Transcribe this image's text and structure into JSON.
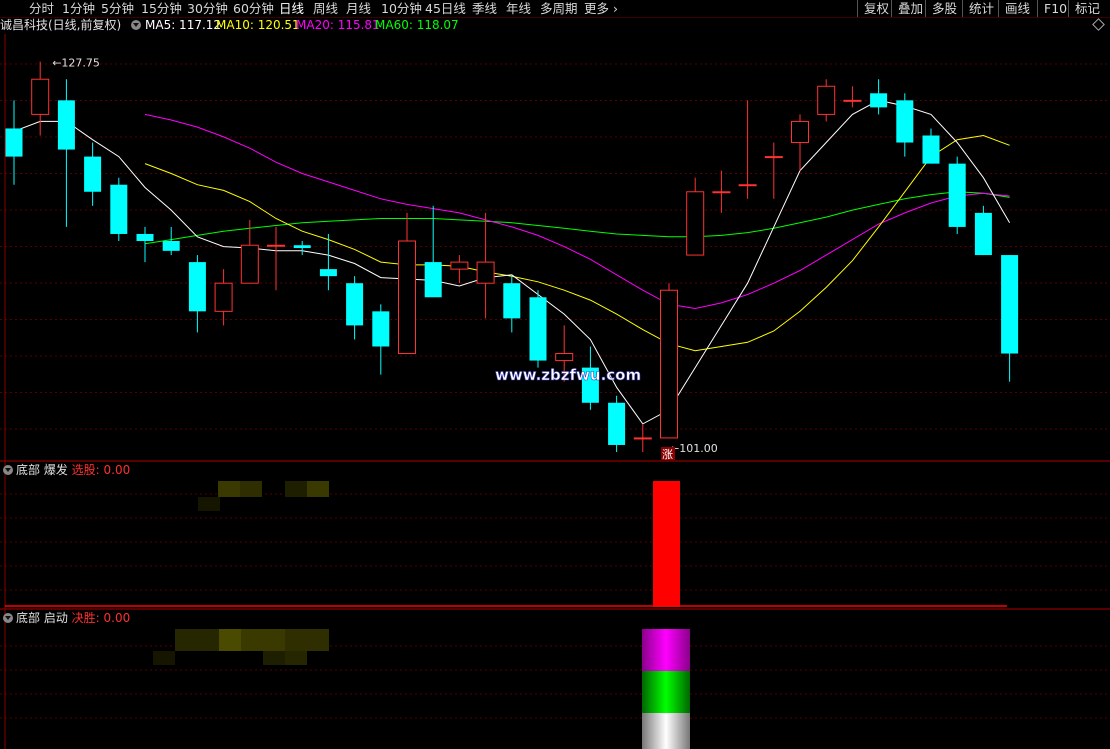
{
  "toolbar": {
    "periods": [
      "分时",
      "1分钟",
      "5分钟",
      "15分钟",
      "30分钟",
      "60分钟",
      "日线",
      "周线",
      "月线",
      "10分钟",
      "45日线",
      "季线",
      "年线",
      "多周期",
      "更多"
    ],
    "active_period": "日线",
    "right_items": [
      "复权",
      "叠加",
      "多股",
      "统计",
      "画线",
      "F10",
      "标记"
    ]
  },
  "stock": {
    "title": "诚昌科技(日线,前复权)"
  },
  "ma_legend": [
    {
      "label": "MA5:",
      "value": "117.12",
      "color": "#ffffff"
    },
    {
      "label": "MA10:",
      "value": "120.51",
      "color": "#ffff00"
    },
    {
      "label": "MA20:",
      "value": "115.81",
      "color": "#ff00ff"
    },
    {
      "label": "MA60:",
      "value": "118.07",
      "color": "#00ff00"
    }
  ],
  "annotations": {
    "high": "127.75",
    "low": "101.00",
    "limit_up_tag": "涨"
  },
  "watermark": "www.zbzfwu.com",
  "panel2": {
    "name": "底部 爆发",
    "indicator": "选股: 0.00"
  },
  "panel3": {
    "name": "底部 启动",
    "indicator": "决胜: 0.00"
  },
  "colors": {
    "up": "#ff3232",
    "down": "#00ffff",
    "ma5": "#ffffff",
    "ma10": "#ffff00",
    "ma20": "#ff00ff",
    "ma60": "#00ff00"
  },
  "chart_data": {
    "type": "candlestick",
    "price_range": [
      100.0,
      130.0
    ],
    "candles": [
      {
        "o": 123.0,
        "h": 125.0,
        "l": 119.0,
        "c": 121.0
      },
      {
        "o": 124.0,
        "h": 127.75,
        "l": 122.5,
        "c": 126.5
      },
      {
        "o": 125.0,
        "h": 126.5,
        "l": 116.0,
        "c": 121.5
      },
      {
        "o": 121.0,
        "h": 122.0,
        "l": 117.5,
        "c": 118.5
      },
      {
        "o": 119.0,
        "h": 119.5,
        "l": 115.0,
        "c": 115.5
      },
      {
        "o": 115.5,
        "h": 116.0,
        "l": 113.5,
        "c": 115.0
      },
      {
        "o": 115.0,
        "h": 116.0,
        "l": 114.0,
        "c": 114.3
      },
      {
        "o": 113.5,
        "h": 114.0,
        "l": 108.5,
        "c": 110.0
      },
      {
        "o": 110.0,
        "h": 113.0,
        "l": 109.0,
        "c": 112.0
      },
      {
        "o": 112.0,
        "h": 116.5,
        "l": 112.0,
        "c": 114.7
      },
      {
        "o": 114.7,
        "h": 116.0,
        "l": 111.5,
        "c": 114.7
      },
      {
        "o": 114.7,
        "h": 115.0,
        "l": 114.0,
        "c": 114.5
      },
      {
        "o": 113.0,
        "h": 115.5,
        "l": 111.5,
        "c": 112.5
      },
      {
        "o": 112.0,
        "h": 112.5,
        "l": 108.0,
        "c": 109.0
      },
      {
        "o": 110.0,
        "h": 110.5,
        "l": 105.5,
        "c": 107.5
      },
      {
        "o": 107.0,
        "h": 117.0,
        "l": 107.0,
        "c": 115.0
      },
      {
        "o": 113.5,
        "h": 117.5,
        "l": 111.5,
        "c": 111.0
      },
      {
        "o": 113.0,
        "h": 114.0,
        "l": 112.0,
        "c": 113.5
      },
      {
        "o": 112.0,
        "h": 117.0,
        "l": 109.5,
        "c": 113.5
      },
      {
        "o": 112.0,
        "h": 112.5,
        "l": 108.5,
        "c": 109.5
      },
      {
        "o": 111.0,
        "h": 111.5,
        "l": 106.0,
        "c": 106.5
      },
      {
        "o": 106.5,
        "h": 109.0,
        "l": 105.0,
        "c": 107.0
      },
      {
        "o": 106.0,
        "h": 107.5,
        "l": 103.0,
        "c": 103.5
      },
      {
        "o": 103.5,
        "h": 104.0,
        "l": 100.0,
        "c": 100.5
      },
      {
        "o": 101.0,
        "h": 102.0,
        "l": 100.0,
        "c": 101.0
      },
      {
        "o": 101.0,
        "h": 112.0,
        "l": 101.0,
        "c": 111.5
      },
      {
        "o": 114.0,
        "h": 119.5,
        "l": 114.0,
        "c": 118.5
      },
      {
        "o": 118.5,
        "h": 120.0,
        "l": 117.0,
        "c": 118.5
      },
      {
        "o": 119.0,
        "h": 125.0,
        "l": 118.0,
        "c": 119.0
      },
      {
        "o": 121.0,
        "h": 122.0,
        "l": 118.0,
        "c": 121.0
      },
      {
        "o": 122.0,
        "h": 124.0,
        "l": 120.0,
        "c": 123.5
      },
      {
        "o": 124.0,
        "h": 126.5,
        "l": 123.5,
        "c": 126.0
      },
      {
        "o": 125.0,
        "h": 126.0,
        "l": 124.5,
        "c": 125.0
      },
      {
        "o": 125.5,
        "h": 126.5,
        "l": 124.0,
        "c": 124.5
      },
      {
        "o": 125.0,
        "h": 125.5,
        "l": 121.0,
        "c": 122.0
      },
      {
        "o": 122.5,
        "h": 123.0,
        "l": 120.5,
        "c": 120.5
      },
      {
        "o": 120.5,
        "h": 121.0,
        "l": 115.5,
        "c": 116.0
      },
      {
        "o": 117.0,
        "h": 117.5,
        "l": 114.0,
        "c": 114.0
      },
      {
        "o": 114.0,
        "h": 114.0,
        "l": 105.0,
        "c": 107.0
      }
    ],
    "ma5": [
      122.8,
      123.5,
      123.5,
      122.2,
      121.0,
      118.8,
      117.2,
      115.3,
      114.6,
      114.5,
      114.3,
      114.3,
      114.0,
      113.4,
      112.4,
      112.3,
      112.2,
      111.8,
      112.4,
      112.6,
      111.2,
      109.8,
      108.0,
      104.6,
      102.0,
      103.0,
      106.0,
      109.0,
      112.0,
      116.0,
      120.0,
      122.0,
      124.0,
      125.0,
      124.6,
      124.0,
      122.0,
      119.5,
      116.3
    ],
    "ma10": [
      null,
      null,
      null,
      null,
      null,
      120.5,
      119.8,
      119.0,
      118.6,
      117.8,
      116.6,
      115.7,
      115.1,
      114.4,
      113.5,
      113.3,
      113.3,
      113.2,
      112.8,
      112.5,
      112.1,
      111.5,
      110.8,
      109.8,
      108.7,
      107.7,
      107.2,
      107.5,
      107.8,
      108.6,
      110.0,
      111.7,
      113.6,
      116.0,
      118.5,
      121.0,
      122.2,
      122.5,
      121.8
    ],
    "ma20": [
      null,
      null,
      null,
      null,
      null,
      124.0,
      123.6,
      123.1,
      122.4,
      121.6,
      120.6,
      119.8,
      119.2,
      118.6,
      118.0,
      117.6,
      117.3,
      117.0,
      116.5,
      116.0,
      115.4,
      114.6,
      113.7,
      112.6,
      111.5,
      110.5,
      110.2,
      110.6,
      111.2,
      112.0,
      112.9,
      114.0,
      115.1,
      116.2,
      117.0,
      117.7,
      118.2,
      118.4,
      118.2
    ],
    "ma60": [
      null,
      null,
      null,
      null,
      null,
      114.8,
      115.1,
      115.4,
      115.7,
      115.9,
      116.1,
      116.3,
      116.4,
      116.5,
      116.6,
      116.6,
      116.6,
      116.5,
      116.4,
      116.3,
      116.1,
      115.9,
      115.7,
      115.5,
      115.4,
      115.3,
      115.3,
      115.4,
      115.6,
      115.9,
      116.3,
      116.7,
      117.2,
      117.6,
      118.0,
      118.3,
      118.5,
      118.4,
      118.1
    ]
  }
}
